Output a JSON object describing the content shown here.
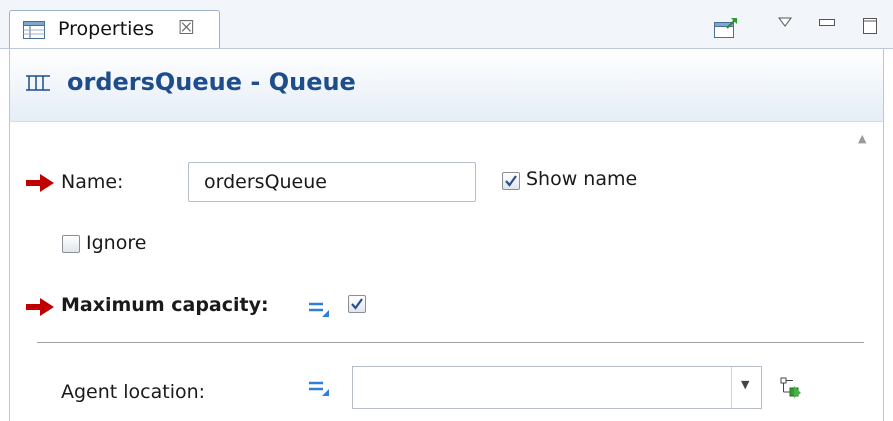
{
  "tab": {
    "label": "Properties",
    "close_glyph": "☒",
    "icon": "properties-table-icon"
  },
  "toolbar": {
    "pin_icon": "pin-to-editor-icon",
    "view_menu_icon": "view-menu-icon",
    "minimize_icon": "minimize-icon",
    "maximize_icon": "maximize-icon"
  },
  "header": {
    "icon": "queue-icon",
    "title": "ordersQueue - Queue",
    "title_color": "#1d4d8a"
  },
  "fields": {
    "name_label": "Name:",
    "name_value": "ordersQueue",
    "show_name_label": "Show name",
    "show_name_checked": true,
    "ignore_label": "Ignore",
    "ignore_checked": false,
    "max_capacity_label": "Maximum capacity:",
    "max_capacity_checked": true,
    "agent_location_label": "Agent location:",
    "agent_location_value": ""
  },
  "colors": {
    "required_arrow": "#c00000",
    "accent": "#2f7fd8",
    "check": "#2a4f8f"
  }
}
